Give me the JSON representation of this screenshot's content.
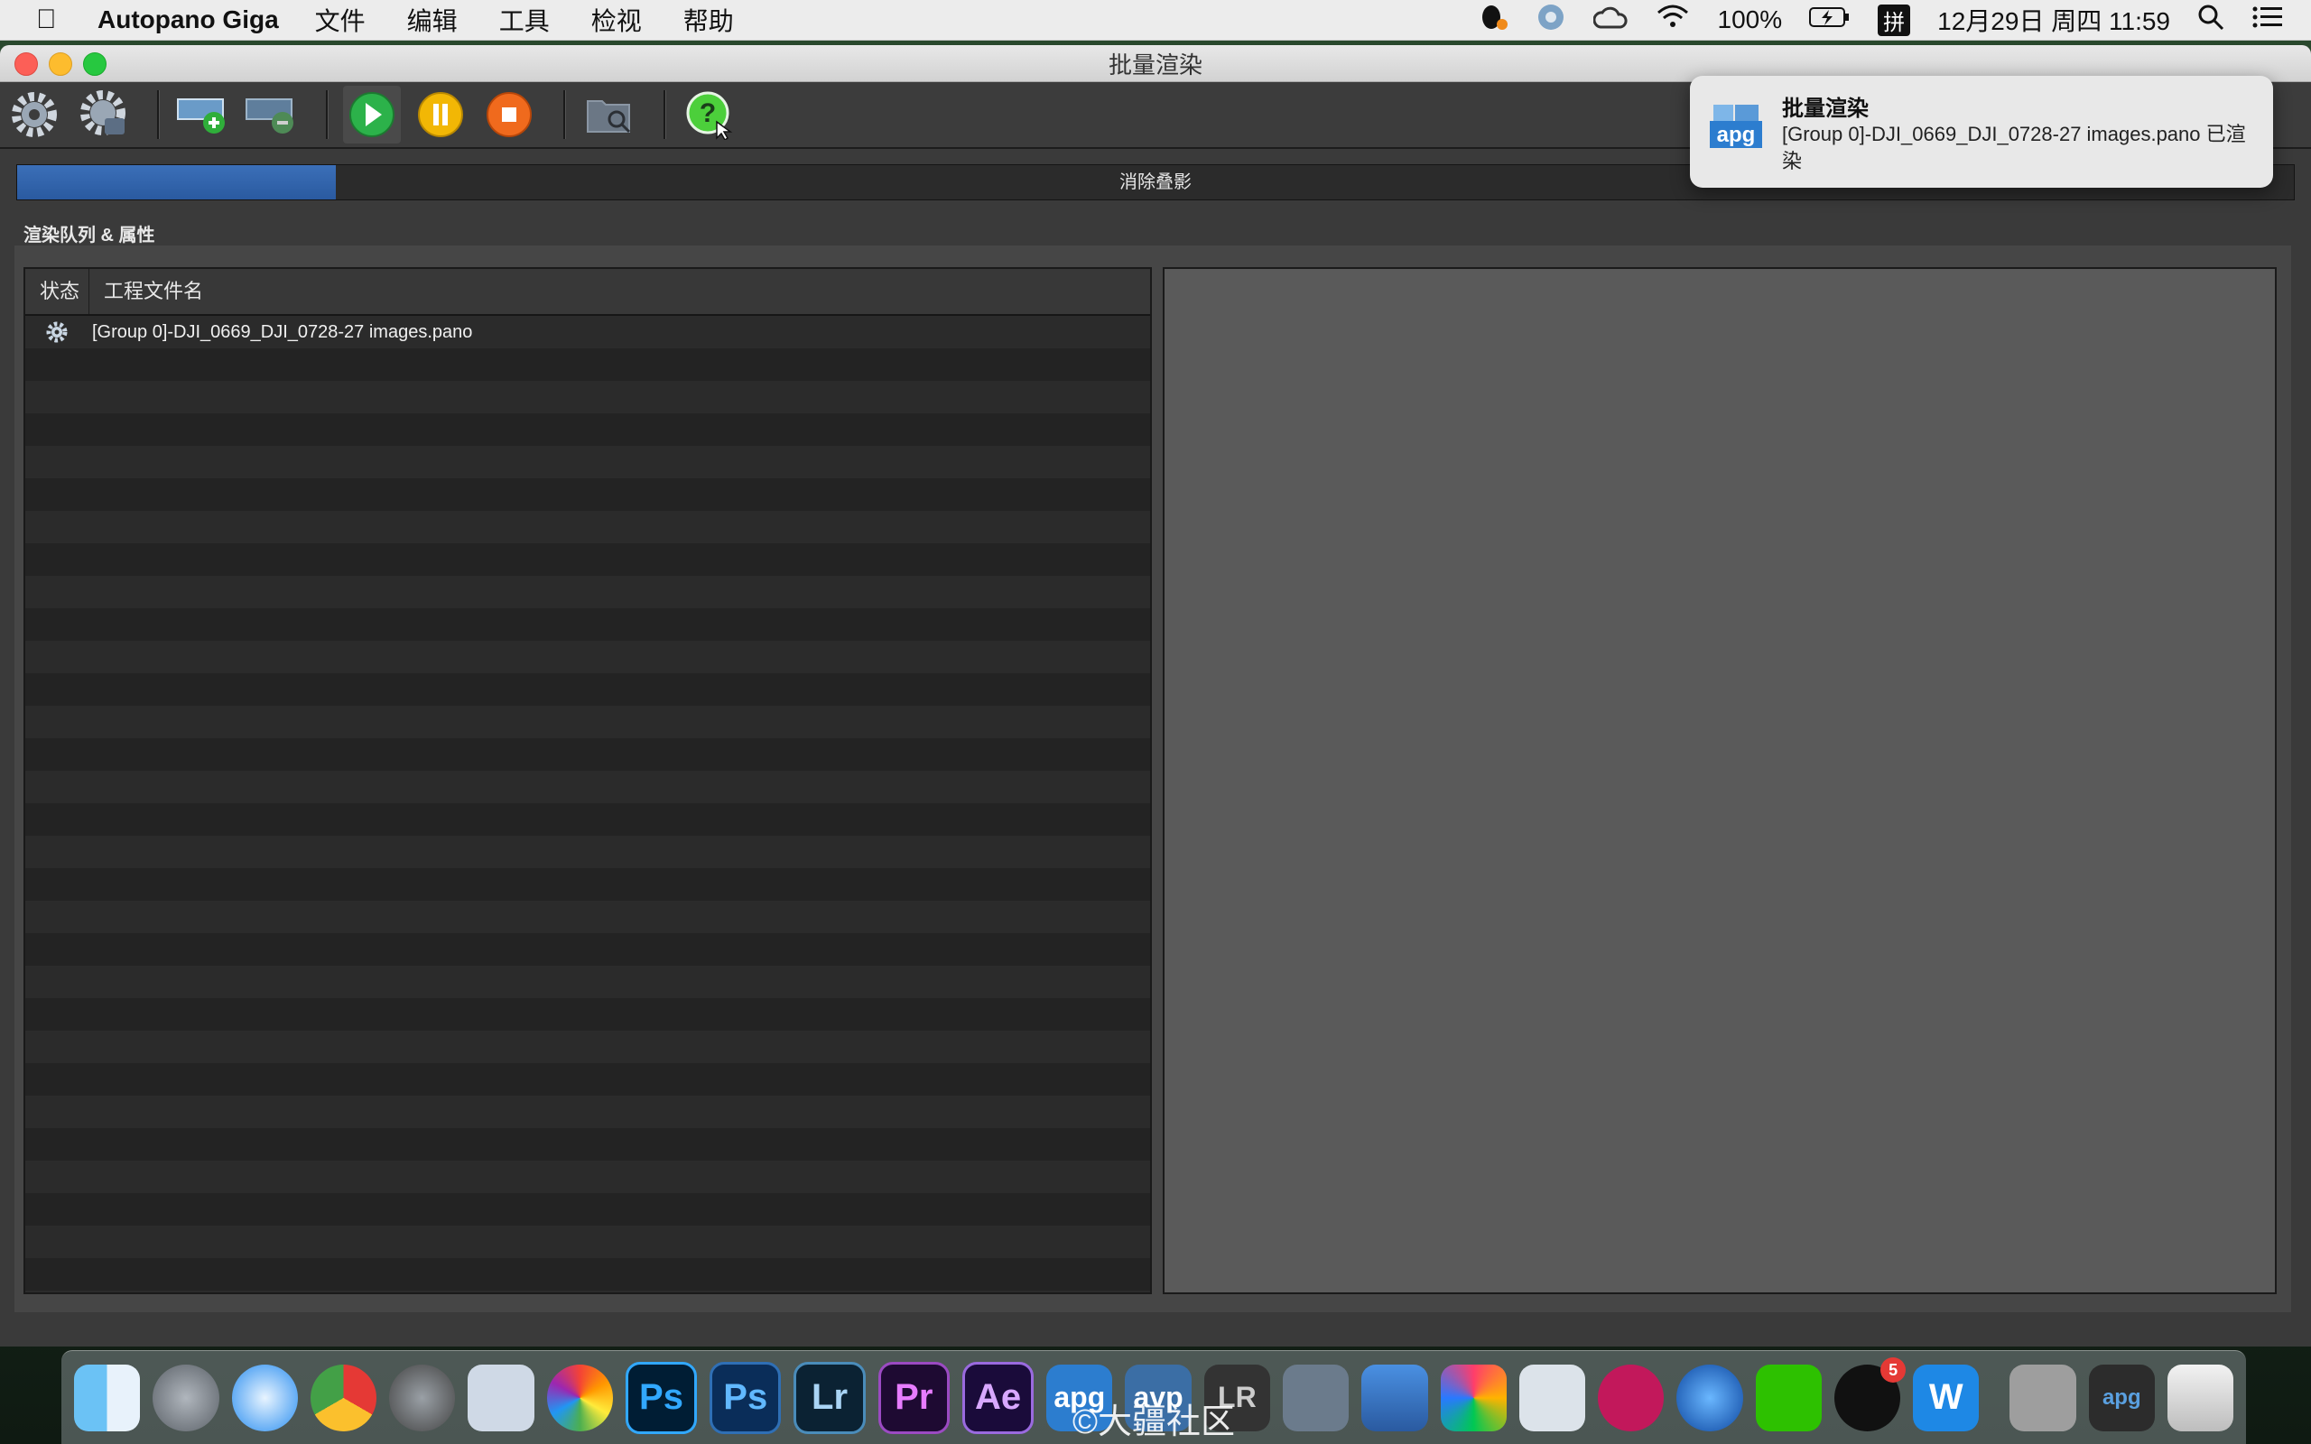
{
  "menubar": {
    "app_name": "Autopano Giga",
    "menus": [
      "文件",
      "编辑",
      "工具",
      "检视",
      "帮助"
    ],
    "battery": "100%",
    "input_method": "拼",
    "clock": "12月29日 周四  11:59"
  },
  "window": {
    "title": "批量渲染"
  },
  "toolbar": {
    "icons": [
      "settings-icon",
      "render-settings-icon",
      "add-item-icon",
      "remove-item-icon",
      "play-icon",
      "pause-icon",
      "stop-icon",
      "browse-folder-icon",
      "help-icon"
    ]
  },
  "progress": {
    "label": "消除叠影",
    "value_fraction": 0.14
  },
  "section": {
    "label": "渲染队列 & 属性"
  },
  "queue": {
    "columns": [
      "状态",
      "工程文件名"
    ],
    "rows": [
      {
        "status_icon": "gear-icon",
        "filename": "[Group 0]-DJI_0669_DJI_0728-27 images.pano"
      }
    ]
  },
  "notification": {
    "app_icon_text": "apg",
    "title": "批量渲染",
    "body": "[Group 0]-DJI_0669_DJI_0728-27 images.pano 已渲染"
  },
  "dock": {
    "items": [
      "Finder",
      "Launchpad",
      "Safari",
      "Chrome",
      "System Preferences",
      "Preview",
      "Photos",
      "Ps",
      "Ps",
      "Lr",
      "Pr",
      "Ae",
      "apg",
      "avp",
      "LR",
      "Photo",
      "Keynote",
      "Final Cut Pro",
      "Compressor",
      "DaVinci Resolve",
      "QuickTime",
      "WeChat",
      "QQ",
      "W",
      "Archive",
      "apg"
    ],
    "qq_badge": "5"
  },
  "watermark": "©大疆社区",
  "colors": {
    "accent_blue": "#2f63ad",
    "play_green": "#2cb24a",
    "pause_yellow": "#f2b705",
    "stop_orange": "#f06a1d"
  }
}
